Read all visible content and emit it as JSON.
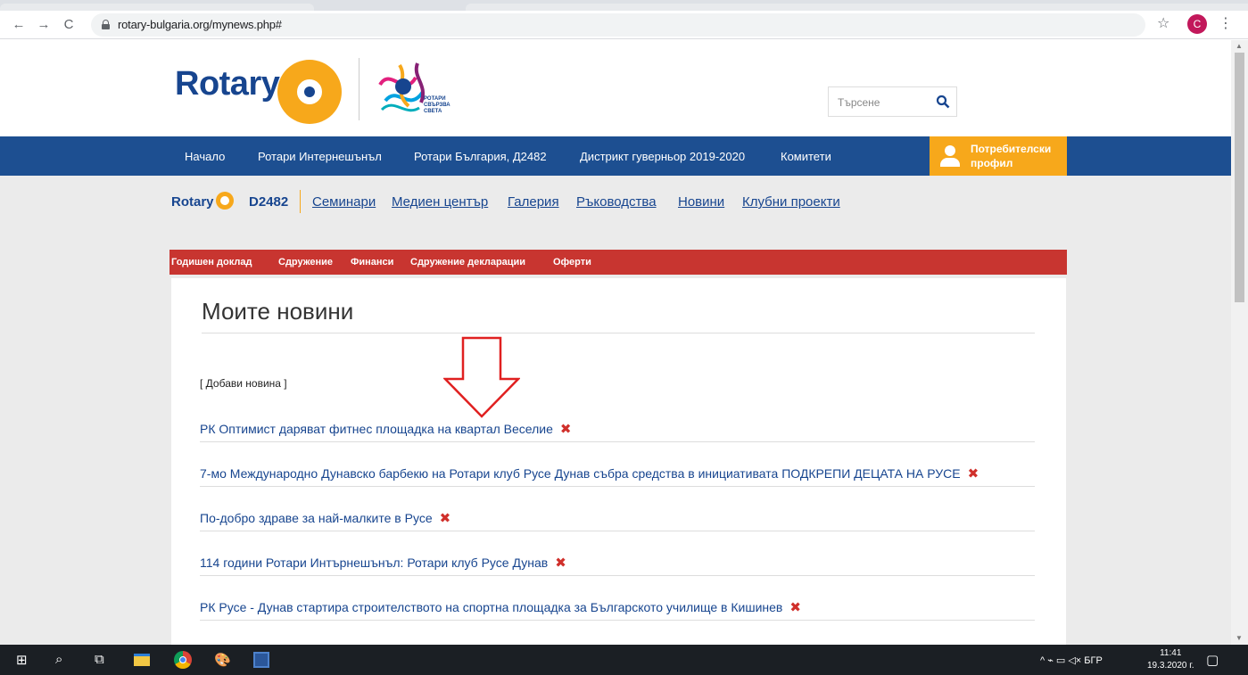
{
  "browser": {
    "back_icon": "←",
    "forward_icon": "→",
    "reload_icon": "C",
    "url": "rotary-bulgaria.org/mynews.php#",
    "star_icon": "☆",
    "avatar_letter": "C",
    "menu_icon": "⋮"
  },
  "header": {
    "logo_text": "Rotary",
    "theme_line1": "РОТАРИ",
    "theme_line2": "СВЪРЗВА",
    "theme_line3": "СВЕТА",
    "search_placeholder": "Търсене"
  },
  "main_nav": {
    "items": [
      "Начало",
      "Ротари Интернешънъл",
      "Ротари България, Д2482",
      "Дистрикт гуверньор 2019-2020",
      "Комитети"
    ],
    "profile_line1": "Потребителски",
    "profile_line2": "профил"
  },
  "sub_nav": {
    "brand": "Rotary",
    "district": "D2482",
    "links": [
      "Семинари",
      "Медиен център",
      "Галерия",
      "Ръководства",
      "Новини",
      "Клубни проекти"
    ]
  },
  "red_nav": {
    "items": [
      "Годишен доклад",
      "Сдружение",
      "Финанси",
      "Сдружение декларации",
      "Оферти"
    ]
  },
  "content": {
    "page_title": "Моите новини",
    "add_news": "[ Добави новина ]",
    "delete_icon": "✖",
    "news": [
      "РК Оптимист даряват фитнес площадка на квартал Веселие",
      "7-мо Международно Дунавско барбекю на Ротари клуб Русе Дунав събра средства в инициативата ПОДКРЕПИ ДЕЦАТА НА РУСЕ",
      "По-добро здраве за най-малките в Русе",
      "114 години Ротари Интърнешънъл: Ротари клуб Русе Дунав",
      "РК Русе - Дунав стартира строителството на спортна площадка за Българското училище в Кишинев"
    ]
  },
  "taskbar": {
    "start_icon": "⊞",
    "search_icon": "⌕",
    "taskview_icon": "⧉",
    "tray_text": "^ ⌁ ▭ ◁× БГР",
    "time": "11:41",
    "date": "19.3.2020 г.",
    "notif_icon": "▢"
  }
}
